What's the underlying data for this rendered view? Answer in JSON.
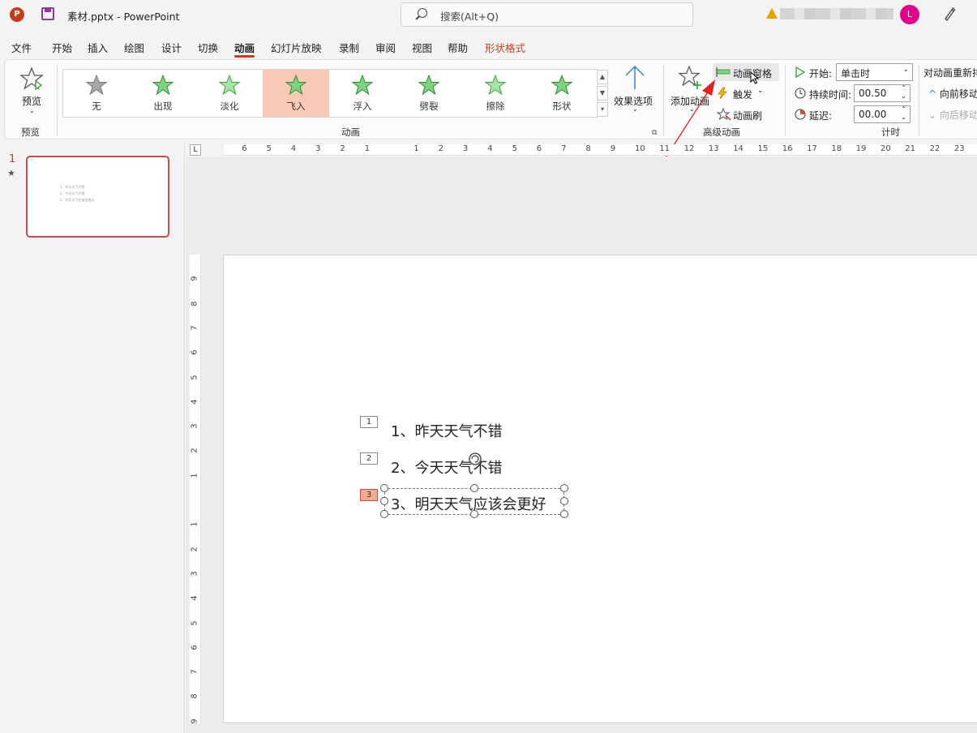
{
  "titlebar": {
    "app_icon_letter": "P",
    "file_title": "素材.pptx  -  PowerPoint",
    "search_placeholder": "搜索(Alt+Q)",
    "avatar_letter": "L"
  },
  "menu": {
    "items": [
      "文件",
      "开始",
      "插入",
      "绘图",
      "设计",
      "切换",
      "动画",
      "幻灯片放映",
      "录制",
      "审阅",
      "视图",
      "帮助",
      "形状格式"
    ],
    "active": "动画"
  },
  "ribbon": {
    "preview_label": "预览",
    "preview_group": "预览",
    "gallery": [
      "无",
      "出现",
      "淡化",
      "飞入",
      "浮入",
      "劈裂",
      "擦除",
      "形状"
    ],
    "gallery_selected": "飞入",
    "effect_options": "效果选项",
    "animation_group": "动画",
    "add_animation": "添加动画",
    "animation_pane": "动画窗格",
    "trigger": "触发",
    "animation_painter": "动画刷",
    "advanced_group": "高级动画",
    "start_label": "开始:",
    "start_value": "单击时",
    "duration_label": "持续时间:",
    "duration_value": "00.50",
    "delay_label": "延迟:",
    "delay_value": "00.00",
    "timing_group": "计时",
    "reorder_label": "对动画重新排",
    "move_earlier": "向前移动",
    "move_later": "向后移动"
  },
  "thumbnails": {
    "slide_number": "1",
    "star": "★",
    "lines": [
      "1、昨天天气不错",
      "2、今天天气不错",
      "3、明天天气应该会更好"
    ]
  },
  "ruler": {
    "h_ticks": [
      "6",
      "5",
      "4",
      "3",
      "2",
      "1",
      "1",
      "2",
      "3",
      "4",
      "5",
      "6",
      "7",
      "8",
      "9",
      "10",
      "11",
      "12",
      "13",
      "14",
      "15",
      "16",
      "17",
      "18",
      "19",
      "20",
      "21",
      "22",
      "23"
    ],
    "v_ticks": [
      "9",
      "8",
      "7",
      "6",
      "5",
      "4",
      "3",
      "2",
      "1",
      "1",
      "2",
      "3",
      "4",
      "5",
      "6",
      "7",
      "8",
      "9"
    ],
    "tab_stop": "L"
  },
  "slide": {
    "items": [
      {
        "tag": "1",
        "text": "1、昨天天气不错"
      },
      {
        "tag": "2",
        "text": "2、今天天气不错"
      },
      {
        "tag": "3",
        "text": "3、明天天气应该会更好"
      }
    ]
  },
  "colors": {
    "accent": "#c43e1c",
    "selected_gallery": "#f8c9b4",
    "star_green": "#5fbf5f",
    "arrow_red": "#e02020"
  }
}
